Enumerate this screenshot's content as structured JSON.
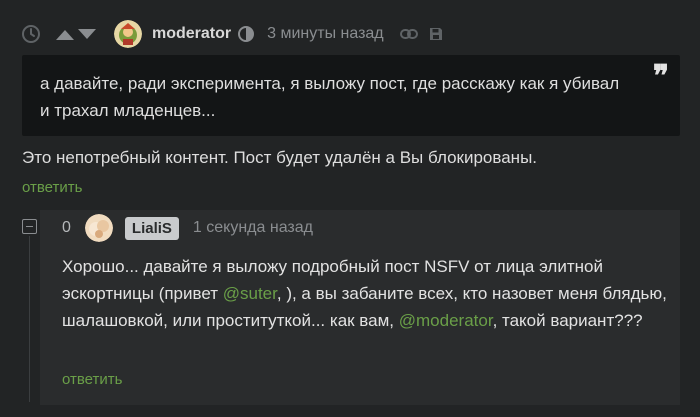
{
  "comment": {
    "author": "moderator",
    "time": "3 минуты назад",
    "quote": "а давайте, ради эксперимента, я выложу пост, где расскажу как я убивал и трахал младенцев...",
    "text": "Это непотребный контент. Пост будет удалён а Вы блокированы.",
    "reply_label": "ответить"
  },
  "reply": {
    "rating": "0",
    "author": "LialiS",
    "time": "1 секунда назад",
    "text_parts": {
      "p1": "Хорошо... давайте я выложу подробный пост NSFV  от лица элитной эскортницы (привет ",
      "mention1": "@suter",
      "p2": ", ), а вы забаните всех, кто назовет меня блядью, шалашовкой, или проституткой... как вам, ",
      "mention2": "@moderator",
      "p3": ", такой вариант???"
    },
    "reply_label": "ответить"
  },
  "icons": {
    "clock": "clock-icon",
    "upvote": "arrow-up-icon",
    "downvote": "arrow-down-icon",
    "moderator_badge": "moderator-icon",
    "link": "link-icon",
    "save": "save-icon",
    "quote": "quote-icon",
    "collapse": "collapse-icon"
  },
  "colors": {
    "background": "#222425",
    "quote_background": "#131516",
    "nested_background": "#2a2c2d",
    "accent_green": "#6a9f48",
    "muted": "#8a8d90"
  }
}
